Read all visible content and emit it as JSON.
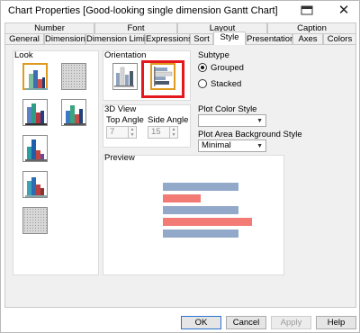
{
  "window": {
    "title": "Chart Properties [Good-looking single dimension Gantt Chart]",
    "close_glyph": "✕"
  },
  "tabs": {
    "row1": [
      "Number",
      "Font",
      "Layout",
      "Caption"
    ],
    "row2": [
      "General",
      "Dimensions",
      "Dimension Limits",
      "Expressions",
      "Sort",
      "Style",
      "Presentation",
      "Axes",
      "Colors"
    ],
    "active": "Style"
  },
  "look": {
    "label": "Look",
    "tiles": [
      {
        "icon": "bar-chart-3d-icon",
        "selected": true
      },
      {
        "icon": "dithered-style-icon",
        "selected": false
      },
      {
        "icon": "bar-chart-3d-icon",
        "selected": false
      },
      {
        "icon": "bar-chart-3d-icon",
        "selected": false
      },
      {
        "icon": "bar-chart-3d-icon",
        "selected": false
      },
      {
        "icon": "bar-chart-3d-icon",
        "selected": false
      },
      {
        "icon": "dithered-style-icon",
        "selected": false
      }
    ]
  },
  "orientation": {
    "label": "Orientation",
    "options": [
      {
        "icon": "vertical-bars-icon",
        "selected": false
      },
      {
        "icon": "horizontal-bars-icon",
        "selected": true
      }
    ]
  },
  "view3d": {
    "label": "3D View",
    "top_angle_label": "Top Angle",
    "top_angle_value": "7",
    "side_angle_label": "Side Angle",
    "side_angle_value": "15"
  },
  "subtype": {
    "label": "Subtype",
    "options": [
      {
        "label": "Grouped",
        "checked": true
      },
      {
        "label": "Stacked",
        "checked": false
      }
    ]
  },
  "plot_color_style": {
    "label": "Plot Color Style",
    "value": ""
  },
  "plot_area_background_style": {
    "label": "Plot Area Background Style",
    "value": "Minimal"
  },
  "preview": {
    "label": "Preview",
    "bar_colors": {
      "blue": "#92a9c9",
      "red": "#f37b76"
    },
    "bars": [
      {
        "color": "blue",
        "fraction": 1.0
      },
      {
        "color": "red",
        "fraction": 0.5
      },
      {
        "color": "blue",
        "fraction": 1.0
      },
      {
        "color": "red",
        "fraction": 1.18
      },
      {
        "color": "blue",
        "fraction": 1.0
      }
    ]
  },
  "buttons": {
    "ok": "OK",
    "cancel": "Cancel",
    "apply": "Apply",
    "help": "Help"
  },
  "colors": {
    "highlight": "#e3191d",
    "selected_border": "#e09a22"
  }
}
